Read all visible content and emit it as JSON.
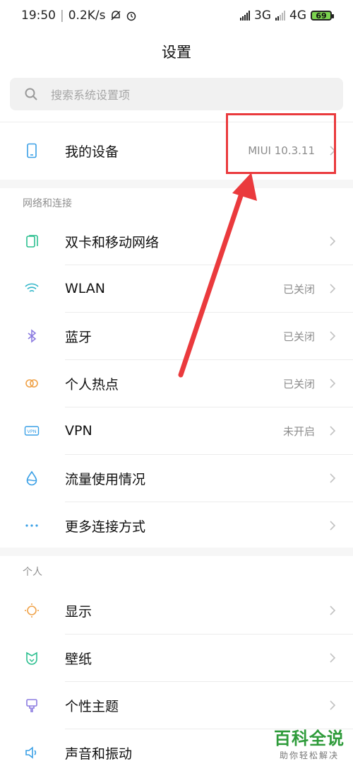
{
  "status_bar": {
    "time": "19:50",
    "speed": "0.2K/s",
    "net1": "3G",
    "net2": "4G",
    "battery": "69"
  },
  "page_title": "设置",
  "search": {
    "placeholder": "搜索系统设置项"
  },
  "my_device": {
    "label": "我的设备",
    "value": "MIUI 10.3.11"
  },
  "sections": {
    "network": {
      "title": "网络和连接",
      "items": [
        {
          "label": "双卡和移动网络",
          "value": "",
          "icon": "sim-card-icon"
        },
        {
          "label": "WLAN",
          "value": "已关闭",
          "icon": "wifi-icon"
        },
        {
          "label": "蓝牙",
          "value": "已关闭",
          "icon": "bluetooth-icon"
        },
        {
          "label": "个人热点",
          "value": "已关闭",
          "icon": "hotspot-icon"
        },
        {
          "label": "VPN",
          "value": "未开启",
          "icon": "vpn-icon"
        },
        {
          "label": "流量使用情况",
          "value": "",
          "icon": "data-usage-icon"
        },
        {
          "label": "更多连接方式",
          "value": "",
          "icon": "more-dots-icon"
        }
      ]
    },
    "personal": {
      "title": "个人",
      "items": [
        {
          "label": "显示",
          "icon": "display-icon"
        },
        {
          "label": "壁纸",
          "icon": "wallpaper-icon"
        },
        {
          "label": "个性主题",
          "icon": "theme-icon"
        },
        {
          "label": "声音和振动",
          "icon": "sound-icon"
        }
      ]
    }
  },
  "watermark": {
    "main": "百科全说",
    "sub": "助你轻松解决"
  },
  "colors": {
    "accent_blue": "#3aa0e6",
    "annotation_red": "#ea3a3d",
    "watermark_green": "#2e9b3a"
  }
}
